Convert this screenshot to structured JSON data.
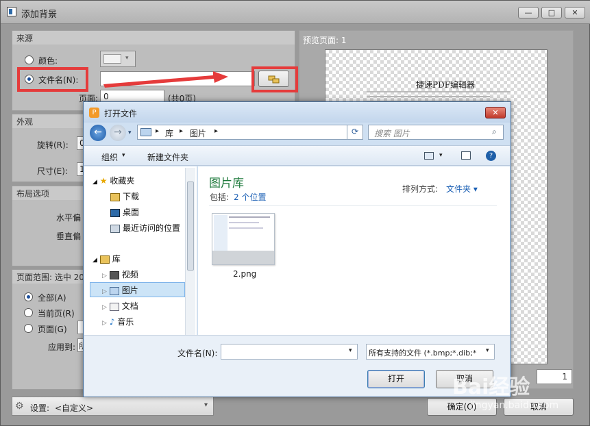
{
  "window": {
    "title": "添加背景",
    "min": "—",
    "max": "□",
    "close": "✕"
  },
  "source": {
    "header": "来源",
    "color_label": "颜色:",
    "filename_label": "文件名(N):",
    "page_label": "页面:",
    "page_value": "0",
    "page_total": "(共0页)"
  },
  "appearance": {
    "header": "外观",
    "rotate_label": "旋转(R):",
    "rotate_value": "0",
    "size_label": "尺寸(E):",
    "size_value": "1"
  },
  "layout": {
    "header": "布局选项",
    "h_offset": "水平偏",
    "v_offset": "垂直偏"
  },
  "page_range": {
    "header": "页面范围: 选中 20",
    "all": "全部(A)",
    "current": "当前页(R)",
    "pages": "页面(G)",
    "apply_label": "应用到:",
    "apply_value": "所"
  },
  "preview": {
    "header": "预览页面: 1",
    "doc_title": "捷速PDF编辑器",
    "page_number": "1"
  },
  "footer": {
    "settings_label": "设置:",
    "settings_value": "<自定义>",
    "ok": "确定(O)",
    "cancel": "取消"
  },
  "dialog": {
    "title": "打开文件",
    "breadcrumb": [
      "库",
      "图片"
    ],
    "search_placeholder": "搜索 图片",
    "organize": "组织",
    "new_folder": "新建文件夹",
    "help": "?",
    "nav": {
      "favorites": "收藏夹",
      "downloads": "下载",
      "desktop": "桌面",
      "recent": "最近访问的位置",
      "libraries": "库",
      "videos": "视频",
      "pictures": "图片",
      "documents": "文档",
      "music": "音乐"
    },
    "library_title": "图片库",
    "library_includes_label": "包括:",
    "library_includes_link": "2 个位置",
    "arrange_label": "排列方式:",
    "arrange_value": "文件夹",
    "file_name": "2.png",
    "filename_label": "文件名(N):",
    "filetype_value": "所有支持的文件 (*.bmp;*.dib;*",
    "open": "打开",
    "cancel": "取消"
  },
  "watermark": {
    "brand": "Bai经验",
    "url": "jingyan.baidu.com"
  },
  "colors": {
    "highlight_red": "#e53b3b",
    "dialog_blue": "#cfe0f2",
    "library_green": "#1e7a3c",
    "link_blue": "#1a5fb4"
  }
}
